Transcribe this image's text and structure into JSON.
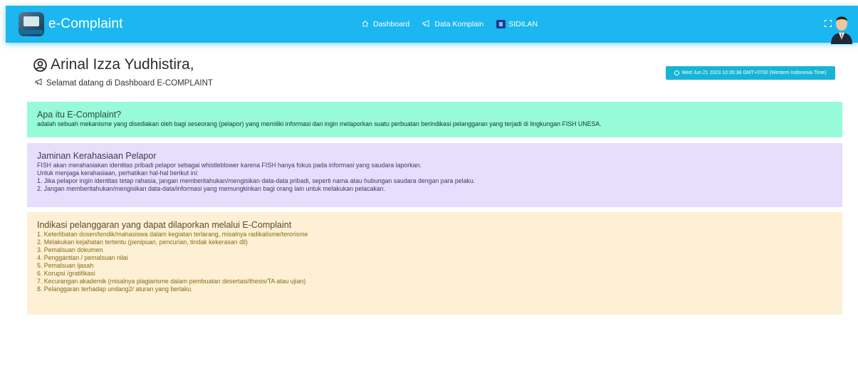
{
  "header": {
    "brand": "e-Complaint",
    "nav": [
      {
        "label": "Dashboard",
        "icon": "home-icon"
      },
      {
        "label": "Data Komplain",
        "icon": "bullhorn-icon"
      },
      {
        "label": "SIDILAN",
        "icon": "sidilan-logo-icon"
      }
    ],
    "fullscreen_icon": "fullscreen-icon",
    "avatar_icon": "user-avatar-icon",
    "color": "#1cb7f0"
  },
  "greeting": {
    "name": "Arinal Izza Yudhistira,",
    "welcome": "Selamat datang di Dashboard E-COMPLAINT",
    "datetime": "Wed Jun 21 2023 10:26:38 GMT+0700 (Western Indonesia Time)"
  },
  "about": {
    "title": "Apa itu E-Complaint?",
    "text": "adalah sebuah mekanisme yang disediakan oleh bagi seseorang (pelapor) yang memiliki informasi dan ingin melaporkan suatu perbuatan berindikasi pelanggaran yang terjadi di lingkungan FISH UNESA.",
    "color": "#97fbd9"
  },
  "guarantee": {
    "title": "Jaminan Kerahasiaan Pelapor",
    "lines": [
      "FISH akan merahasiakan identitas pribadi pelapor sebagai whistleblower karena FISH hanya fokus pada informasi yang saudara laporkan.",
      "Untuk menjaga kerahasiaan, perhatikan hal-hal berikut ini:",
      "1. Jika pelapor ingin identitas tetap rahasia, jangan memberitahukan/mengisikan data-data pribadi, seperti nama atau hubungan saudara dengan para pelaku.",
      "2. Jangan memberitahukan/mengisikan data-data/informasi yang memungkinkan bagi orang lain untuk melakukan pelacakan."
    ],
    "color": "#e6defb"
  },
  "indication": {
    "title": "Indikasi pelanggaran yang dapat dilaporkan melalui E-Complaint",
    "items": [
      "1. Keterlibatan dosen/tendik/mahasiswa dalam kegiatan terlarang, misalnya radikalisme/terorisme",
      "2. Melakukan kejahatan tertentu (penipuan, pencurian, tindak kekerasan dll)",
      "3. Pemalsuan dokumen",
      "4. Penggantian / pemalsuan nilai",
      "5. Pemalsuan ijasah",
      "6. Korupsi /gratifikasi",
      "7. Kecurangan akademik (misalnya plagiarisme dalam pembuatan desertasi/thesis/TA atau ujian)",
      "8. Pelanggaran terhadap undang2/ aturan yang berlaku."
    ],
    "color": "#fdf0d4"
  }
}
